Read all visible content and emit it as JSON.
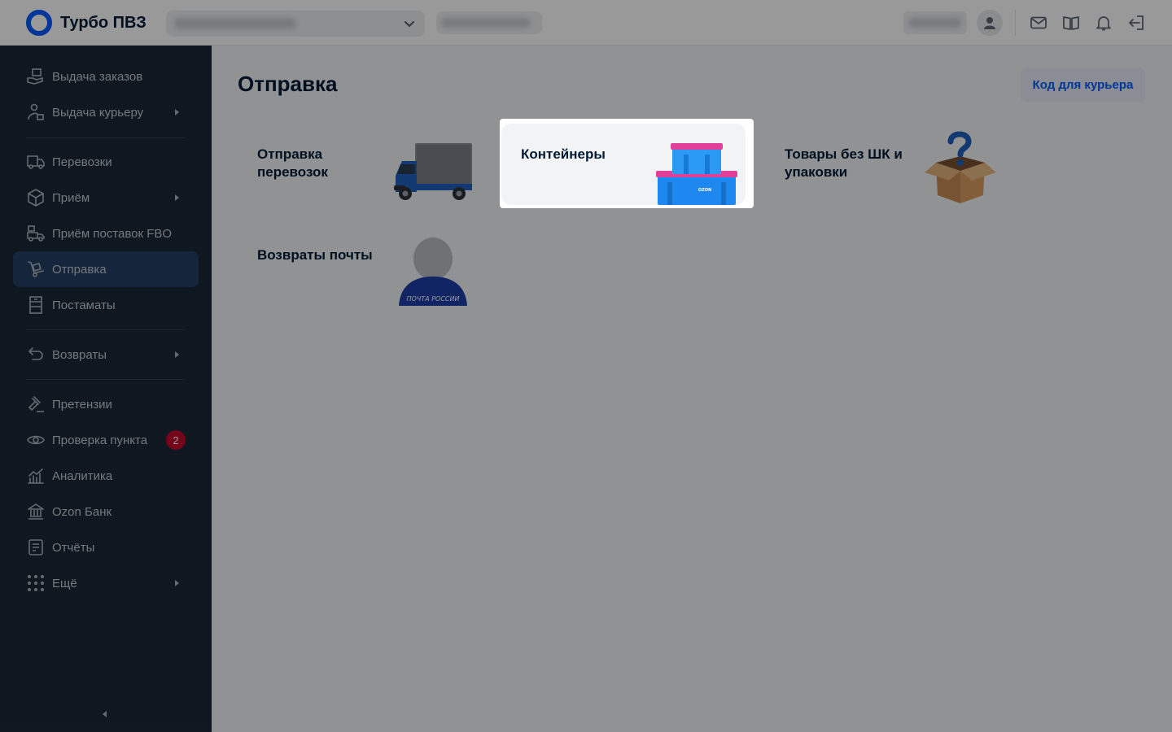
{
  "app": {
    "title": "Турбо ПВЗ"
  },
  "topbar": {
    "icons": [
      "user-icon",
      "mail-icon",
      "book-icon",
      "bell-icon",
      "logout-icon"
    ]
  },
  "sidebar": {
    "items": [
      {
        "label": "Выдача заказов",
        "icon": "hand-package-icon"
      },
      {
        "label": "Выдача курьеру",
        "icon": "courier-icon",
        "has_submenu": true
      },
      {
        "label": "Перевозки",
        "icon": "truck-icon"
      },
      {
        "label": "Приём",
        "icon": "box-icon",
        "has_submenu": true
      },
      {
        "label": "Приём поставок FBO",
        "icon": "delivery-truck-icon"
      },
      {
        "label": "Отправка",
        "icon": "dolly-icon",
        "active": true
      },
      {
        "label": "Постаматы",
        "icon": "locker-icon"
      },
      {
        "label": "Возвраты",
        "icon": "return-icon",
        "has_submenu": true
      },
      {
        "label": "Претензии",
        "icon": "gavel-icon"
      },
      {
        "label": "Проверка пункта",
        "icon": "eye-icon",
        "badge": "2"
      },
      {
        "label": "Аналитика",
        "icon": "chart-icon"
      },
      {
        "label": "Ozon Банк",
        "icon": "bank-icon"
      },
      {
        "label": "Отчёты",
        "icon": "report-icon"
      },
      {
        "label": "Ещё",
        "icon": "grid-dots-icon",
        "has_submenu": true
      }
    ]
  },
  "main": {
    "title": "Отправка",
    "courier_button": "Код для курьера",
    "cards": [
      {
        "title": "Отправка перевозок",
        "art": "truck-illustration"
      },
      {
        "title": "Контейнеры",
        "art": "containers-illustration",
        "highlighted": true
      },
      {
        "title": "Товары без ШК и упаковки",
        "art": "question-box-illustration"
      },
      {
        "title": "Возвраты почты",
        "art": "mail-person-illustration"
      }
    ],
    "container_brand": "OZON",
    "mail_person_text": "ПОЧТА РОССИИ"
  },
  "colors": {
    "sidebar_bg": "#1a2838",
    "sidebar_active": "#233f63",
    "accent": "#005bff",
    "badge": "#c3082e",
    "overlay": "rgba(0,0,0,0.4)"
  }
}
